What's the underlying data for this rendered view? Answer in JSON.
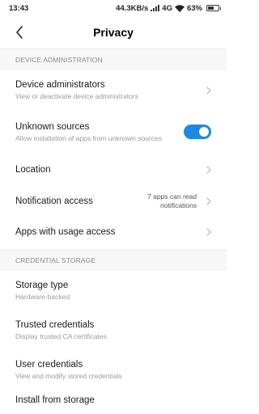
{
  "status_bar": {
    "time": "13:43",
    "network_speed": "44.3KB/s",
    "network_type": "4G",
    "battery_percent": "63%",
    "battery_level": 0.63
  },
  "header": {
    "title": "Privacy",
    "back_icon": "back-arrow-icon"
  },
  "sections": {
    "device_admin": {
      "header": "DEVICE ADMINISTRATION",
      "device_administrators": {
        "title": "Device administrators",
        "summary": "View or deactivate device administrators"
      },
      "unknown_sources": {
        "title": "Unknown sources",
        "summary": "Allow installation of apps from unknown sources",
        "enabled": true
      },
      "location": {
        "title": "Location"
      },
      "notification_access": {
        "title": "Notification access",
        "value": "7 apps can read notifications"
      },
      "usage_access": {
        "title": "Apps with usage access"
      }
    },
    "credential_storage": {
      "header": "CREDENTIAL STORAGE",
      "storage_type": {
        "title": "Storage type",
        "summary": "Hardware-backed"
      },
      "trusted_credentials": {
        "title": "Trusted credentials",
        "summary": "Display trusted CA certificates"
      },
      "user_credentials": {
        "title": "User credentials",
        "summary": "View and modify stored credentials"
      },
      "install_from_storage": {
        "title": "Install from storage"
      }
    }
  },
  "colors": {
    "accent": "#1e88e5",
    "section_background": "#f7f7f7",
    "summary_text": "#9a9a9a"
  }
}
